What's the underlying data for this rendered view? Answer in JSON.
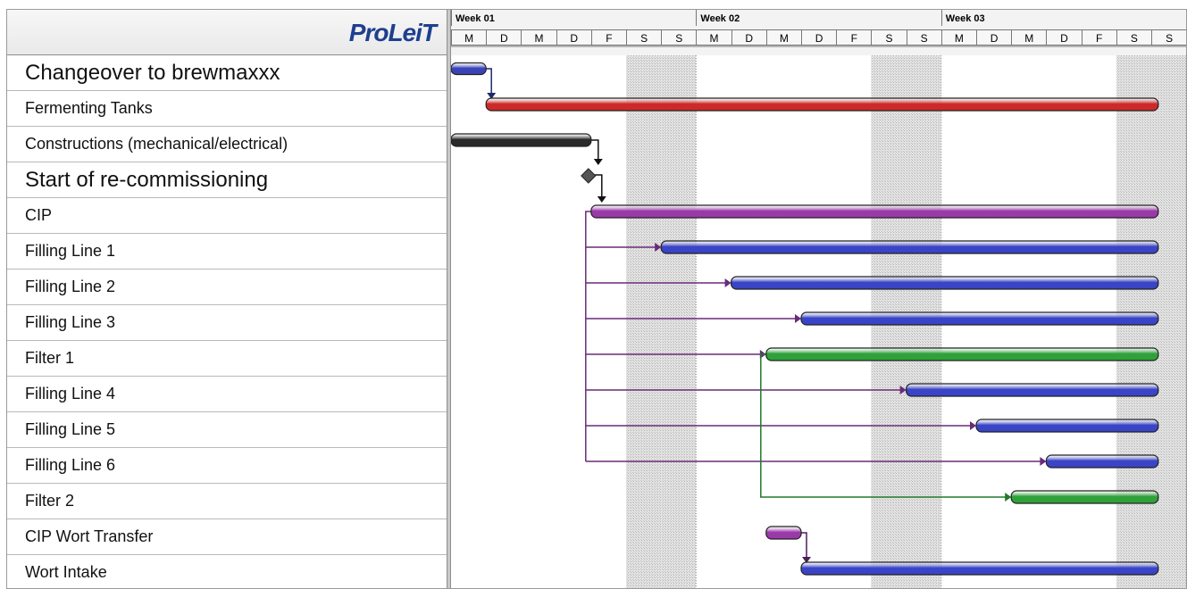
{
  "app": {
    "logo_text": "ProLeiT"
  },
  "timeline": {
    "weeks": [
      "Week 01",
      "Week 02",
      "Week 03"
    ],
    "days": [
      "M",
      "D",
      "M",
      "D",
      "F",
      "S",
      "S",
      "M",
      "D",
      "M",
      "D",
      "F",
      "S",
      "S",
      "M",
      "D",
      "M",
      "D",
      "F",
      "S",
      "S"
    ]
  },
  "tasks": [
    {
      "label": "Changeover to brewmaxxx",
      "type": "summary",
      "start_day": 1.0,
      "end_day": 2.0,
      "color": "#3a44b6"
    },
    {
      "label": "Fermenting Tanks",
      "type": "bar",
      "start_day": 2.0,
      "end_day": 21.2,
      "color": "#cc2a2a"
    },
    {
      "label": "Constructions (mechanical/electrical)",
      "type": "bar",
      "start_day": 1.0,
      "end_day": 5.0,
      "color": "#2a2a2a"
    },
    {
      "label": "Start of re-commissioning",
      "type": "milestone",
      "start_day": 5.0,
      "end_day": 5.0,
      "color": "#555555"
    },
    {
      "label": "CIP",
      "type": "bar",
      "start_day": 5.0,
      "end_day": 21.2,
      "color": "#9a3aa8"
    },
    {
      "label": "Filling Line 1",
      "type": "bar",
      "start_day": 7.0,
      "end_day": 21.2,
      "color": "#3a44c6"
    },
    {
      "label": "Filling Line 2",
      "type": "bar",
      "start_day": 9.0,
      "end_day": 21.2,
      "color": "#3a44c6"
    },
    {
      "label": "Filling Line 3",
      "type": "bar",
      "start_day": 11.0,
      "end_day": 21.2,
      "color": "#3a44c6"
    },
    {
      "label": "Filter 1",
      "type": "bar",
      "start_day": 10.0,
      "end_day": 21.2,
      "color": "#2fa13a"
    },
    {
      "label": "Filling Line 4",
      "type": "bar",
      "start_day": 14.0,
      "end_day": 21.2,
      "color": "#3a44c6"
    },
    {
      "label": "Filling Line 5",
      "type": "bar",
      "start_day": 16.0,
      "end_day": 21.2,
      "color": "#3a44c6"
    },
    {
      "label": "Filling Line 6",
      "type": "bar",
      "start_day": 18.0,
      "end_day": 21.2,
      "color": "#3a44c6"
    },
    {
      "label": "Filter 2",
      "type": "bar",
      "start_day": 17.0,
      "end_day": 21.2,
      "color": "#2fa13a"
    },
    {
      "label": "CIP Wort Transfer",
      "type": "bar",
      "start_day": 10.0,
      "end_day": 11.0,
      "color": "#9a3aa8"
    },
    {
      "label": "Wort Intake",
      "type": "bar",
      "start_day": 11.0,
      "end_day": 21.2,
      "color": "#3a44c6"
    }
  ]
}
